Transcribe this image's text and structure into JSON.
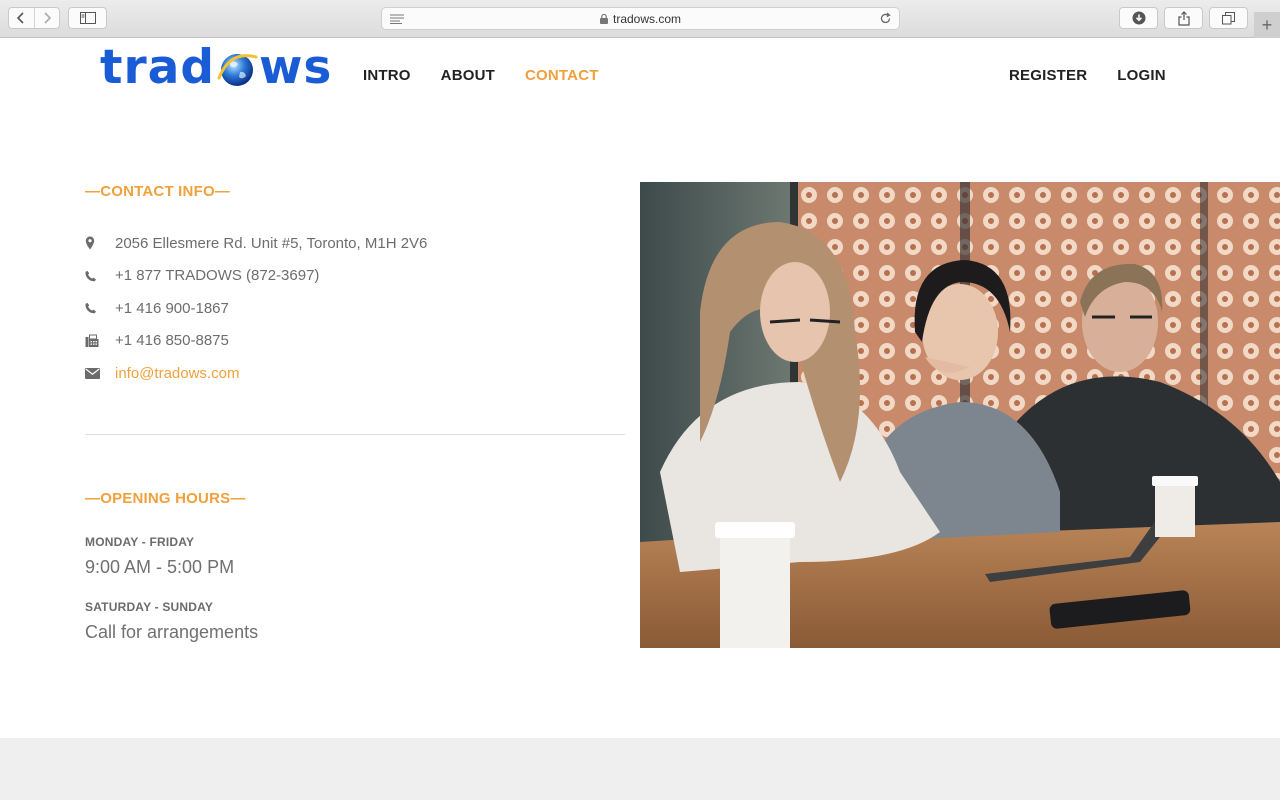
{
  "browser": {
    "url": "tradows.com"
  },
  "header": {
    "logo_text_left": "trad",
    "logo_text_right": "ws",
    "nav": [
      {
        "label": "INTRO",
        "active": false
      },
      {
        "label": "ABOUT",
        "active": false
      },
      {
        "label": "CONTACT",
        "active": true
      }
    ],
    "auth": {
      "register_label": "REGISTER",
      "login_label": "LOGIN"
    }
  },
  "contact": {
    "title": "—CONTACT INFO—",
    "address": "2056 Ellesmere Rd. Unit #5, Toronto, M1H 2V6",
    "phone_toll_free": "+1 877 TRADOWS (872-3697)",
    "phone_local": "+1 416 900-1867",
    "fax": "+1 416 850-8875",
    "email": "info@tradows.com"
  },
  "hours": {
    "title": "—OPENING HOURS—",
    "weekday_label": "MONDAY - FRIDAY",
    "weekday_value": "9:00 AM - 5:00 PM",
    "weekend_label": "SATURDAY - SUNDAY",
    "weekend_value": "Call for arrangements"
  },
  "colors": {
    "accent": "#f0a03c",
    "logo_blue": "#1a5bd6",
    "text_gray": "#6d6d6d"
  }
}
